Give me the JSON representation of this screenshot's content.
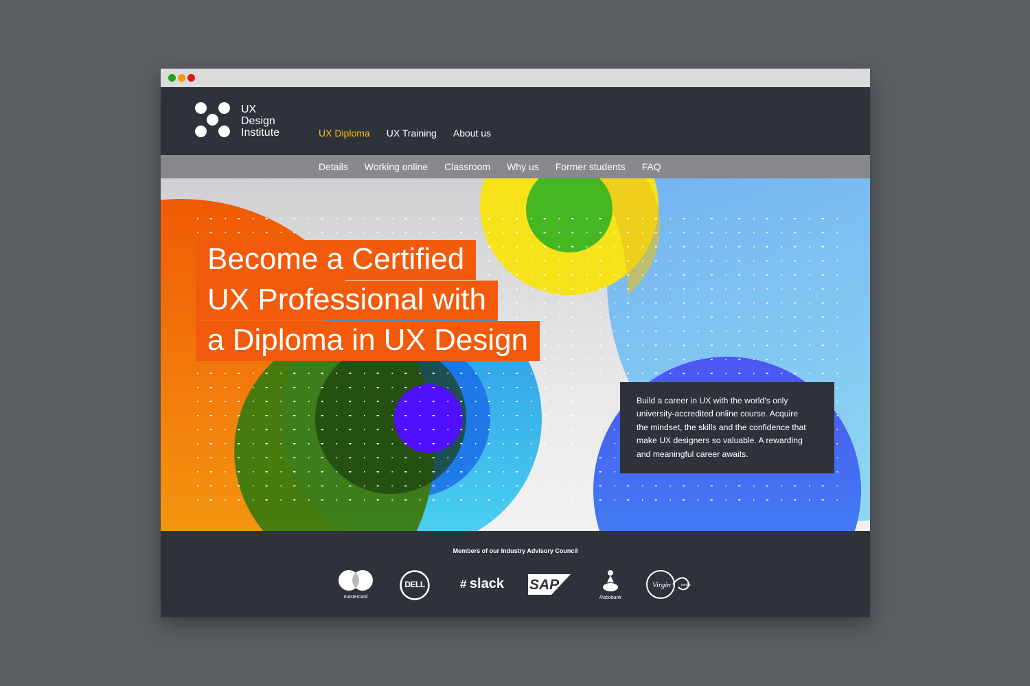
{
  "brand": {
    "line1": "UX",
    "line2": "Design",
    "line3": "Institute"
  },
  "main_nav": [
    {
      "label": "UX Diploma",
      "active": true
    },
    {
      "label": "UX Training",
      "active": false
    },
    {
      "label": "About us",
      "active": false
    }
  ],
  "sub_nav": [
    "Details",
    "Working online",
    "Classroom",
    "Why us",
    "Former students",
    "FAQ"
  ],
  "hero": {
    "headline_lines": [
      "Become a Certified",
      "UX Professional with",
      "a Diploma in UX Design"
    ],
    "intro_lines": [
      "Build a career in UX with the world's only",
      "university-accredited online course.  Acquire",
      "the mindset, the skills and the confidence that",
      "make UX designers so valuable.  A rewarding",
      "and meaningful career awaits."
    ]
  },
  "footer": {
    "title": "Members of our Industry Advisory Council",
    "partners": [
      {
        "name": "mastercard",
        "icon": "mastercard-logo"
      },
      {
        "name": "DELL",
        "icon": "dell-logo"
      },
      {
        "name": "slack",
        "icon": "slack-logo"
      },
      {
        "name": "SAP",
        "icon": "sap-logo"
      },
      {
        "name": "Rabobank",
        "icon": "rabobank-logo"
      },
      {
        "name": "Virgin media",
        "icon": "virgin-media-logo"
      }
    ]
  },
  "colors": {
    "page_bg": "#5b5f63",
    "dark": "#2e333b",
    "subnav_bg": "#87898c",
    "accent_nav": "#f4c400",
    "headline_bg": "#f25a0c",
    "traffic": [
      "#1ea51e",
      "#f59a00",
      "#e81212"
    ]
  }
}
